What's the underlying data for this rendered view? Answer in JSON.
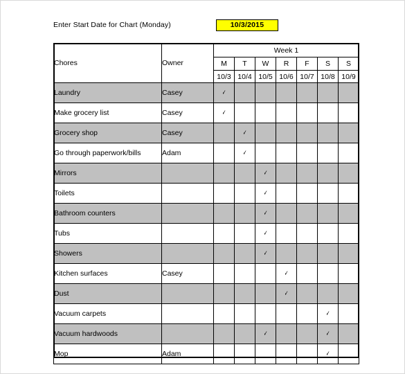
{
  "header": {
    "start_date_label": "Enter Start Date for Chart (Monday)",
    "start_date_value": "10/3/2015",
    "highlight_color": "#ffff00"
  },
  "table": {
    "col_chores": "Chores",
    "col_owner": "Owner",
    "week_label": "Week 1",
    "days": [
      "M",
      "T",
      "W",
      "R",
      "F",
      "S",
      "S"
    ],
    "dates": [
      "10/3",
      "10/4",
      "10/5",
      "10/6",
      "10/7",
      "10/8",
      "10/9"
    ],
    "check_glyph": "✓",
    "shade_color": "#c0c0c0",
    "rows": [
      {
        "chore": "Laundry",
        "owner": "Casey",
        "checks": [
          1,
          0,
          0,
          0,
          0,
          0,
          0
        ],
        "shaded": true
      },
      {
        "chore": "Make grocery list",
        "owner": "Casey",
        "checks": [
          1,
          0,
          0,
          0,
          0,
          0,
          0
        ],
        "shaded": false
      },
      {
        "chore": "Grocery shop",
        "owner": "Casey",
        "checks": [
          0,
          1,
          0,
          0,
          0,
          0,
          0
        ],
        "shaded": true
      },
      {
        "chore": "Go through paperwork/bills",
        "owner": "Adam",
        "checks": [
          0,
          1,
          0,
          0,
          0,
          0,
          0
        ],
        "shaded": false
      },
      {
        "chore": "Mirrors",
        "owner": "",
        "checks": [
          0,
          0,
          1,
          0,
          0,
          0,
          0
        ],
        "shaded": true
      },
      {
        "chore": "Toilets",
        "owner": "",
        "checks": [
          0,
          0,
          1,
          0,
          0,
          0,
          0
        ],
        "shaded": false
      },
      {
        "chore": "Bathroom counters",
        "owner": "",
        "checks": [
          0,
          0,
          1,
          0,
          0,
          0,
          0
        ],
        "shaded": true
      },
      {
        "chore": "Tubs",
        "owner": "",
        "checks": [
          0,
          0,
          1,
          0,
          0,
          0,
          0
        ],
        "shaded": false
      },
      {
        "chore": "Showers",
        "owner": "",
        "checks": [
          0,
          0,
          1,
          0,
          0,
          0,
          0
        ],
        "shaded": true
      },
      {
        "chore": "Kitchen surfaces",
        "owner": "Casey",
        "checks": [
          0,
          0,
          0,
          1,
          0,
          0,
          0
        ],
        "shaded": false
      },
      {
        "chore": "Dust",
        "owner": "",
        "checks": [
          0,
          0,
          0,
          1,
          0,
          0,
          0
        ],
        "shaded": true
      },
      {
        "chore": "Vacuum carpets",
        "owner": "",
        "checks": [
          0,
          0,
          0,
          0,
          0,
          1,
          0
        ],
        "shaded": false
      },
      {
        "chore": "Vacuum hardwoods",
        "owner": "",
        "checks": [
          0,
          0,
          1,
          0,
          0,
          1,
          0
        ],
        "shaded": true
      },
      {
        "chore": "Mop",
        "owner": "Adam",
        "checks": [
          0,
          0,
          0,
          0,
          0,
          1,
          0
        ],
        "shaded": false
      }
    ]
  }
}
